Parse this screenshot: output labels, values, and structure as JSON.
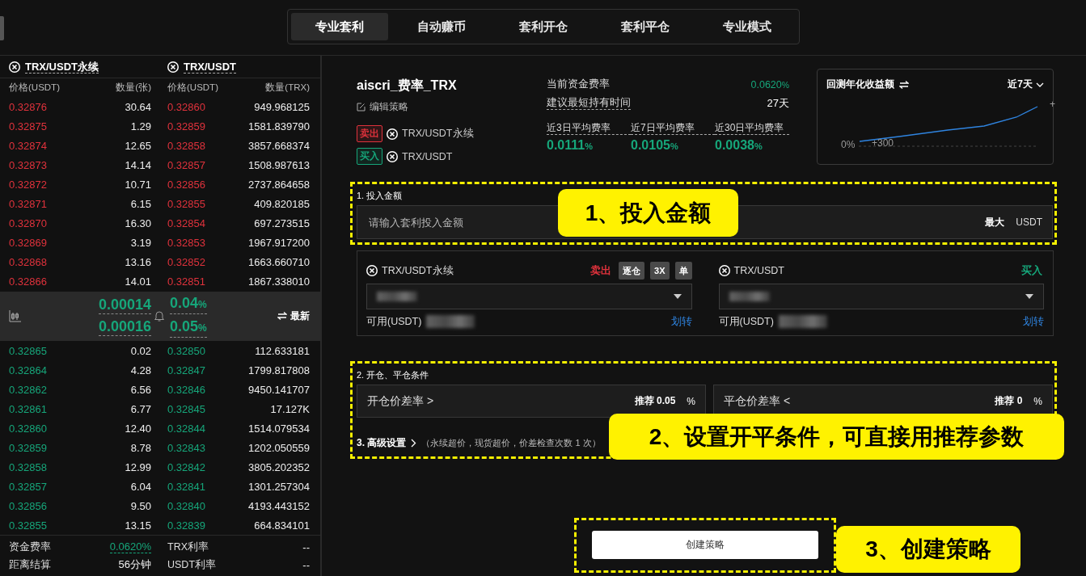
{
  "top_tabs": [
    {
      "label": "专业套利",
      "selected": true
    },
    {
      "label": "自动赚币",
      "selected": false
    },
    {
      "label": "套利开仓",
      "selected": false
    },
    {
      "label": "套利平仓",
      "selected": false
    },
    {
      "label": "专业模式",
      "selected": false
    }
  ],
  "orderbook": {
    "markets": [
      "TRX/USDT永续",
      "TRX/USDT"
    ],
    "columns": [
      "价格(USDT)",
      "数量(张)",
      "价格(USDT)",
      "数量(TRX)"
    ],
    "asks": [
      [
        "0.32876",
        "30.64",
        "0.32860",
        "949.968125"
      ],
      [
        "0.32875",
        "1.29",
        "0.32859",
        "1581.839790"
      ],
      [
        "0.32874",
        "12.65",
        "0.32858",
        "3857.668374"
      ],
      [
        "0.32873",
        "14.14",
        "0.32857",
        "1508.987613"
      ],
      [
        "0.32872",
        "10.71",
        "0.32856",
        "2737.864658"
      ],
      [
        "0.32871",
        "6.15",
        "0.32855",
        "409.820185"
      ],
      [
        "0.32870",
        "16.30",
        "0.32854",
        "697.273515"
      ],
      [
        "0.32869",
        "3.19",
        "0.32853",
        "1967.917200"
      ],
      [
        "0.32868",
        "13.16",
        "0.32852",
        "1663.660710"
      ],
      [
        "0.32866",
        "14.01",
        "0.32851",
        "1867.338010"
      ]
    ],
    "spread": {
      "values": [
        "0.00014",
        "0.00016"
      ],
      "percents": [
        "0.04",
        "0.05"
      ],
      "unit": "%",
      "sort_label": "最新"
    },
    "bids": [
      [
        "0.32865",
        "0.02",
        "0.32850",
        "112.633181"
      ],
      [
        "0.32864",
        "4.28",
        "0.32847",
        "1799.817808"
      ],
      [
        "0.32862",
        "6.56",
        "0.32846",
        "9450.141707"
      ],
      [
        "0.32861",
        "6.77",
        "0.32845",
        "17.127K"
      ],
      [
        "0.32860",
        "12.40",
        "0.32844",
        "1514.079534"
      ],
      [
        "0.32859",
        "8.78",
        "0.32843",
        "1202.050559"
      ],
      [
        "0.32858",
        "12.99",
        "0.32842",
        "3805.202352"
      ],
      [
        "0.32857",
        "6.04",
        "0.32841",
        "1301.257304"
      ],
      [
        "0.32856",
        "9.50",
        "0.32840",
        "4193.443152"
      ],
      [
        "0.32855",
        "13.15",
        "0.32839",
        "664.834101"
      ]
    ],
    "stats": [
      {
        "label": "资金费率",
        "value": "0.0620%",
        "highlighted": true
      },
      {
        "label": "TRX利率",
        "value": "--",
        "highlighted": false
      },
      {
        "label": "距离结算",
        "value": "56分钟",
        "highlighted": false
      },
      {
        "label": "USDT利率",
        "value": "--",
        "highlighted": false
      }
    ]
  },
  "strategy": {
    "name": "aiscri_费率_TRX",
    "edit_label": "编辑策略",
    "legs": [
      {
        "side_label": "卖出",
        "color": "#e0323c",
        "market": "TRX/USDT永续"
      },
      {
        "side_label": "买入",
        "color": "#16a67a",
        "market": "TRX/USDT"
      }
    ],
    "current_rate": {
      "label": "当前资金费率",
      "value": "0.0620",
      "unit": "%"
    },
    "min_hold": {
      "label": "建议最短持有时间",
      "value": "27天"
    },
    "avg_rates": [
      {
        "label": "近3日平均费率",
        "value": "0.0111",
        "unit": "%"
      },
      {
        "label": "近7日平均费率",
        "value": "0.0105",
        "unit": "%"
      },
      {
        "label": "近30日平均费率",
        "value": "0.0038",
        "unit": "%"
      }
    ]
  },
  "backtest": {
    "title": "回测年化收益额",
    "period": "近7天",
    "y_label": "0%",
    "point_label": "+300",
    "corner_label": "+"
  },
  "step1": {
    "title": "1. 投入金额",
    "placeholder": "请输入套利投入金额",
    "max_label": "最大",
    "unit": "USDT"
  },
  "accounts": [
    {
      "market": "TRX/USDT永续",
      "side_label": "卖出",
      "color": "#e0323c",
      "options": [
        "逐仓",
        "3X",
        "单"
      ],
      "available_label": "可用(USDT)",
      "transfer_label": "划转"
    },
    {
      "market": "TRX/USDT",
      "side_label": "买入",
      "color": "#16a67a",
      "available_label": "可用(USDT)",
      "transfer_label": "划转"
    }
  ],
  "step2": {
    "title": "2. 开仓、平仓条件",
    "fields": [
      {
        "label": "开仓价差率 >",
        "recommend_label": "推荐",
        "recommend_value": "0.05",
        "unit": "%"
      },
      {
        "label": "平仓价差率 <",
        "recommend_label": "推荐",
        "recommend_value": "0",
        "unit": "%"
      }
    ]
  },
  "advanced": {
    "title": "3. 高级设置",
    "note": "（永续超价，现货超价，价差检查次数 1 次）"
  },
  "create_button": "创建策略",
  "callouts": [
    "1、投入金额",
    "2、设置开平条件，可直接用推荐参数",
    "3、创建策略"
  ]
}
